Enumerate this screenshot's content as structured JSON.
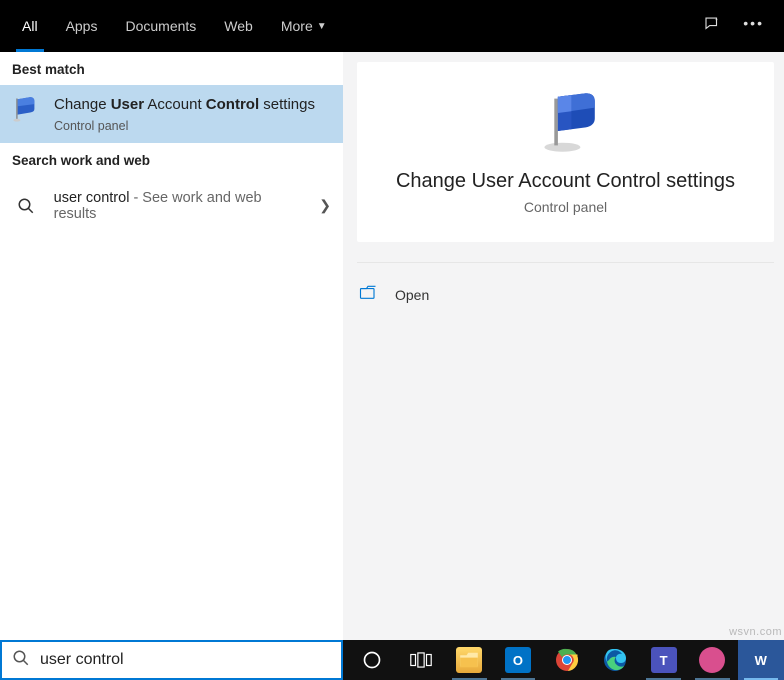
{
  "tabs": {
    "all": "All",
    "apps": "Apps",
    "documents": "Documents",
    "web": "Web",
    "more": "More"
  },
  "sections": {
    "best_match": "Best match",
    "search_work_web": "Search work and web"
  },
  "best_match": {
    "title_pre": "Change ",
    "title_b1": "User",
    "title_mid": " Account ",
    "title_b2": "Control",
    "title_post": " settings",
    "subtitle": "Control panel"
  },
  "web_result": {
    "query": "user control",
    "hint": " - See work and web results"
  },
  "preview": {
    "title": "Change User Account Control settings",
    "subtitle": "Control panel"
  },
  "actions": {
    "open": "Open"
  },
  "search": {
    "value": "user control"
  },
  "watermark": "wsvn.com"
}
